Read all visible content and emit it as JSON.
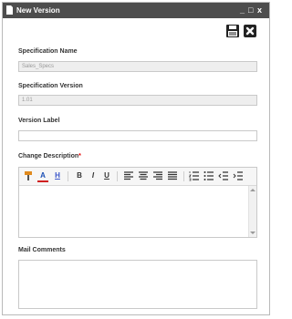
{
  "window": {
    "title": "New Version",
    "minimize": "_",
    "maximize": "□",
    "close": "x"
  },
  "toolbar": {
    "save_icon": "save-icon",
    "close_icon": "close-icon"
  },
  "form": {
    "spec_name_label": "Specification Name",
    "spec_name_value": "Sales_Specs",
    "spec_version_label": "Specification Version",
    "spec_version_value": "1.01",
    "version_label_label": "Version Label",
    "version_label_value": "",
    "change_desc_label": "Change Description",
    "required_mark": "*",
    "mail_comments_label": "Mail Comments"
  },
  "editor_toolbar": {
    "font_color": "A",
    "highlight": "H",
    "bold": "B",
    "italic": "I",
    "underline": "U"
  },
  "colors": {
    "titlebar": "#4d4d4d",
    "required": "#e60000"
  }
}
